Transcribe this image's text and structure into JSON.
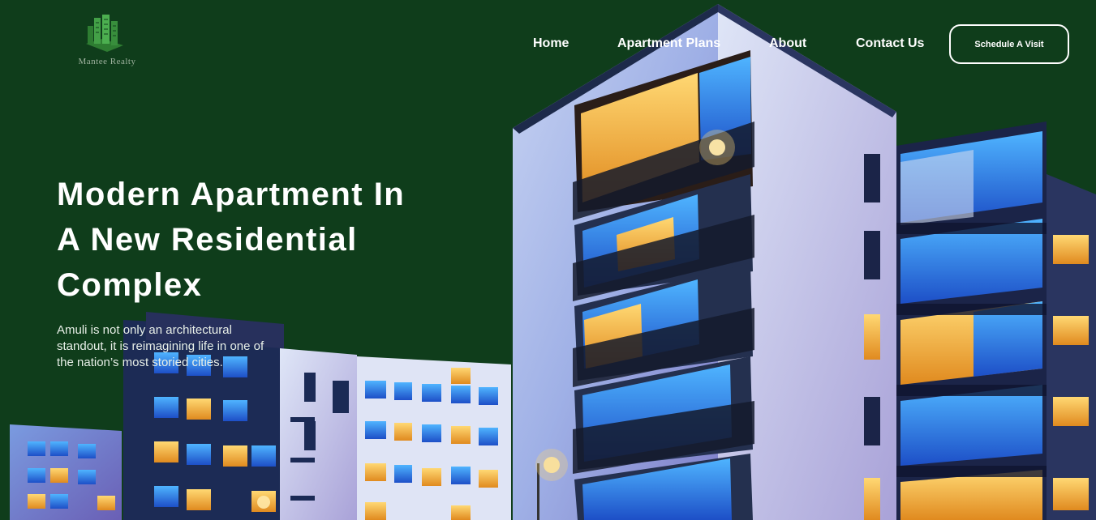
{
  "brand": {
    "name": "Mantee Realty",
    "logo_icon": "building-icon",
    "logo_color": "#3fa34d"
  },
  "nav": {
    "items": [
      {
        "label": "Home"
      },
      {
        "label": "Apartment Plans"
      },
      {
        "label": "About"
      },
      {
        "label": "Contact Us"
      }
    ],
    "cta_label": "Schedule A Visit"
  },
  "hero": {
    "title_lines": [
      "Modern Apartment In",
      "A New Residential",
      "Complex"
    ],
    "description": "Amuli is not only an architectural standout, it is reimagining life in one of the nation’s most storied cities."
  },
  "colors": {
    "background": "#0f3d1b",
    "text": "#ffffff",
    "accent": "#3fa34d"
  }
}
